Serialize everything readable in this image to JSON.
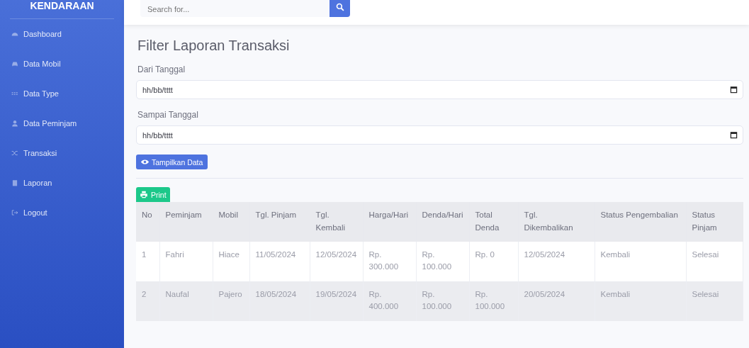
{
  "sidebar": {
    "brand": "KENDARAAN",
    "items": [
      {
        "label": "Dashboard",
        "kind": "gauge"
      },
      {
        "label": "Data Mobil",
        "kind": "car"
      },
      {
        "label": "Data Type",
        "kind": "grid"
      },
      {
        "label": "Data Peminjam",
        "kind": "user"
      },
      {
        "label": "Transaksi",
        "kind": "shuffle"
      },
      {
        "label": "Laporan",
        "kind": "clipboard"
      },
      {
        "label": "Logout",
        "kind": "logout"
      }
    ]
  },
  "topbar": {
    "search": {
      "placeholder": "Search for..."
    }
  },
  "filter": {
    "title": "Filter Laporan Transaksi",
    "fields": [
      {
        "label": "Dari Tanggal",
        "placeholder": "hh/bb/tttt"
      },
      {
        "label": "Sampai Tanggal",
        "placeholder": "hh/bb/tttt"
      }
    ],
    "button": "Tampilkan Data"
  },
  "print_button": "Print",
  "table": {
    "columns": [
      "No",
      "Peminjam",
      "Mobil",
      "Tgl. Pinjam",
      "Tgl. Kembali",
      "Harga/Hari",
      "Denda/Hari",
      "Total Denda",
      "Tgl. Dikembalikan",
      "Status Pengembalian",
      "Status Pinjam"
    ],
    "rows": [
      [
        "1",
        "Fahri",
        "Hiace",
        "11/05/2024",
        "12/05/2024",
        "Rp. 300.000",
        "Rp. 100.000",
        "Rp. 0",
        "12/05/2024",
        "Kembali",
        "Selesai"
      ],
      [
        "2",
        "Naufal",
        "Pajero",
        "18/05/2024",
        "19/05/2024",
        "Rp. 400.000",
        "Rp. 100.000",
        "Rp. 100.000",
        "20/05/2024",
        "Kembali",
        "Selesai"
      ]
    ]
  }
}
